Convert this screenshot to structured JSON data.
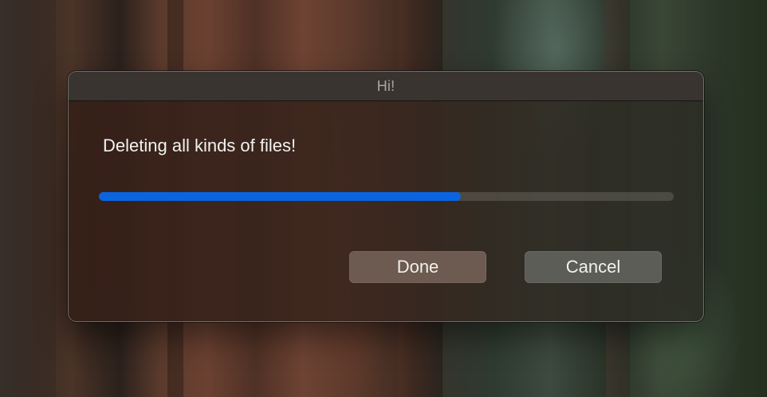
{
  "dialog": {
    "title": "Hi!",
    "message": "Deleting all kinds of files!",
    "progress_fraction": 0.63,
    "buttons": {
      "done_label": "Done",
      "cancel_label": "Cancel"
    }
  },
  "colors": {
    "progress_fill": "#0a64e0",
    "progress_track": "#4a4740",
    "title_text": "#a9a6a3",
    "message_text": "#f2f2f2",
    "done_button": "#6d5a50",
    "cancel_button": "#5c5d57"
  }
}
